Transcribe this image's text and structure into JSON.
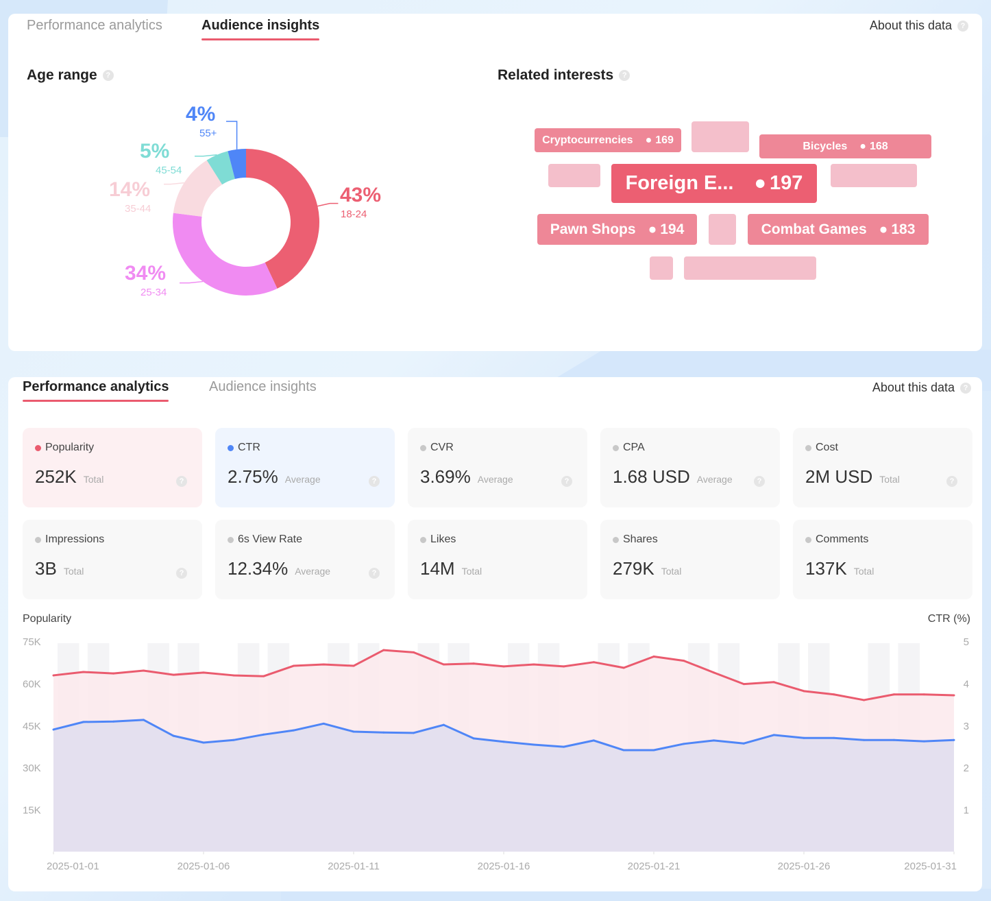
{
  "audience_card": {
    "tabs": [
      {
        "label": "Performance analytics",
        "active": false
      },
      {
        "label": "Audience insights",
        "active": true
      }
    ],
    "about_label": "About this data",
    "age_range": {
      "title": "Age range",
      "slices": [
        {
          "range": "18-24",
          "percent": 43,
          "label": "43%",
          "color": "#ec5f72"
        },
        {
          "range": "25-34",
          "percent": 34,
          "label": "34%",
          "color": "#f08bf2"
        },
        {
          "range": "35-44",
          "percent": 14,
          "label": "14%",
          "color": "#f9dbe0"
        },
        {
          "range": "45-54",
          "percent": 5,
          "label": "5%",
          "color": "#7fdcd5"
        },
        {
          "range": "55+",
          "percent": 4,
          "label": "4%",
          "color": "#4f86f7"
        }
      ]
    },
    "related_interests": {
      "title": "Related interests",
      "items": [
        {
          "name": "Cryptocurrencies",
          "score": "169"
        },
        {
          "name": "Bicycles",
          "score": "168"
        },
        {
          "name": "Foreign E...",
          "score": "197"
        },
        {
          "name": "Pawn Shops",
          "score": "194"
        },
        {
          "name": "Combat Games",
          "score": "183"
        }
      ]
    }
  },
  "performance_card": {
    "tabs": [
      {
        "label": "Performance analytics",
        "active": true
      },
      {
        "label": "Audience insights",
        "active": false
      }
    ],
    "about_label": "About this data",
    "metrics": [
      {
        "label": "Popularity",
        "value": "252K",
        "agg": "Total",
        "dot": "#ea5b6e",
        "selected": "popularity",
        "help": true
      },
      {
        "label": "CTR",
        "value": "2.75%",
        "agg": "Average",
        "dot": "#4f86f7",
        "selected": "ctr",
        "help": true
      },
      {
        "label": "CVR",
        "value": "3.69%",
        "agg": "Average",
        "dot": "#c8c8c8",
        "selected": "",
        "help": true
      },
      {
        "label": "CPA",
        "value": "1.68 USD",
        "agg": "Average",
        "dot": "#c8c8c8",
        "selected": "",
        "help": true
      },
      {
        "label": "Cost",
        "value": "2M USD",
        "agg": "Total",
        "dot": "#c8c8c8",
        "selected": "",
        "help": true
      },
      {
        "label": "Impressions",
        "value": "3B",
        "agg": "Total",
        "dot": "#c8c8c8",
        "selected": "",
        "help": true
      },
      {
        "label": "6s View Rate",
        "value": "12.34%",
        "agg": "Average",
        "dot": "#c8c8c8",
        "selected": "",
        "help": true
      },
      {
        "label": "Likes",
        "value": "14M",
        "agg": "Total",
        "dot": "#c8c8c8",
        "selected": "",
        "help": false
      },
      {
        "label": "Shares",
        "value": "279K",
        "agg": "Total",
        "dot": "#c8c8c8",
        "selected": "",
        "help": false
      },
      {
        "label": "Comments",
        "value": "137K",
        "agg": "Total",
        "dot": "#c8c8c8",
        "selected": "",
        "help": false
      }
    ]
  },
  "chart_data": [
    {
      "type": "pie",
      "title": "Age range",
      "categories": [
        "18-24",
        "25-34",
        "35-44",
        "45-54",
        "55+"
      ],
      "values": [
        43,
        34,
        14,
        5,
        4
      ],
      "unit": "%"
    },
    {
      "type": "line",
      "title": "",
      "ylabel": "Popularity",
      "y2label": "CTR (%)",
      "ylim": [
        0,
        75000
      ],
      "y2lim": [
        0,
        5
      ],
      "yticks": [
        "15K",
        "30K",
        "45K",
        "60K",
        "75K"
      ],
      "yticks_values": [
        15000,
        30000,
        45000,
        60000,
        75000
      ],
      "y2ticks": [
        "1",
        "2",
        "3",
        "4",
        "5"
      ],
      "y2ticks_values": [
        1,
        2,
        3,
        4,
        5
      ],
      "xtick_labels": [
        "2025-01-01",
        "2025-01-06",
        "2025-01-11",
        "2025-01-16",
        "2025-01-21",
        "2025-01-26",
        "2025-01-31"
      ],
      "xtick_indices": [
        0,
        5,
        10,
        15,
        20,
        25,
        30
      ],
      "x": [
        "2025-01-01",
        "2025-01-02",
        "2025-01-03",
        "2025-01-04",
        "2025-01-05",
        "2025-01-06",
        "2025-01-07",
        "2025-01-08",
        "2025-01-09",
        "2025-01-10",
        "2025-01-11",
        "2025-01-12",
        "2025-01-13",
        "2025-01-14",
        "2025-01-15",
        "2025-01-16",
        "2025-01-17",
        "2025-01-18",
        "2025-01-19",
        "2025-01-20",
        "2025-01-21",
        "2025-01-22",
        "2025-01-23",
        "2025-01-24",
        "2025-01-25",
        "2025-01-26",
        "2025-01-27",
        "2025-01-28",
        "2025-01-29",
        "2025-01-30",
        "2025-01-31"
      ],
      "series": [
        {
          "name": "Popularity",
          "axis": "left",
          "color": "#ea5b6e",
          "fill": "#fbe9ec",
          "values": [
            62800,
            64000,
            63500,
            64500,
            63000,
            63800,
            62800,
            62500,
            66200,
            66700,
            66200,
            71800,
            71000,
            66700,
            67000,
            66000,
            66700,
            66000,
            67500,
            65500,
            69500,
            68000,
            63800,
            59700,
            60400,
            57200,
            56000,
            54000,
            56000,
            56000,
            55700
          ]
        },
        {
          "name": "CTR",
          "axis": "right",
          "color": "#4f86f7",
          "fill": "#e3dfee",
          "values": [
            2.9,
            3.08,
            3.09,
            3.13,
            2.75,
            2.59,
            2.65,
            2.78,
            2.88,
            3.04,
            2.85,
            2.83,
            2.82,
            3.01,
            2.69,
            2.61,
            2.54,
            2.49,
            2.64,
            2.41,
            2.41,
            2.56,
            2.64,
            2.57,
            2.77,
            2.7,
            2.7,
            2.65,
            2.65,
            2.62,
            2.65
          ]
        }
      ],
      "grid": false,
      "legend": "none"
    }
  ]
}
